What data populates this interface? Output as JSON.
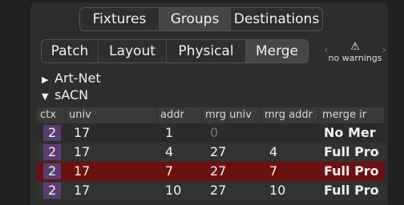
{
  "top_tabs": [
    "Fixtures",
    "Groups",
    "Destinations"
  ],
  "top_active_index": 1,
  "sub_tabs": [
    "Patch",
    "Layout",
    "Physical",
    "Merge"
  ],
  "sub_active_index": 3,
  "nav": {
    "prev_icon": "chevron-left",
    "next_icon": "chevron-right"
  },
  "warnings": {
    "icon": "warning-triangle",
    "text": "no warnings"
  },
  "tree": [
    {
      "label": "Art-Net",
      "expanded": false
    },
    {
      "label": "sACN",
      "expanded": true
    }
  ],
  "table": {
    "headers": [
      "ctx",
      "univ",
      "addr",
      "mrg univ",
      "mrg addr",
      "merge ir"
    ],
    "rows": [
      {
        "ctx": "2",
        "univ": "17",
        "addr": "1",
        "mrg_univ": "0",
        "mrg_addr": "",
        "merge": "No Mer",
        "selected": false
      },
      {
        "ctx": "2",
        "univ": "17",
        "addr": "4",
        "mrg_univ": "27",
        "mrg_addr": "4",
        "merge": "Full Pro",
        "selected": false
      },
      {
        "ctx": "2",
        "univ": "17",
        "addr": "7",
        "mrg_univ": "27",
        "mrg_addr": "7",
        "merge": "Full Pro",
        "selected": true
      },
      {
        "ctx": "2",
        "univ": "17",
        "addr": "10",
        "mrg_univ": "27",
        "mrg_addr": "10",
        "merge": "Full Pro",
        "selected": false
      }
    ]
  },
  "colors": {
    "selected_row": "#6c1111",
    "ctx_badge": "#5a3e73"
  }
}
